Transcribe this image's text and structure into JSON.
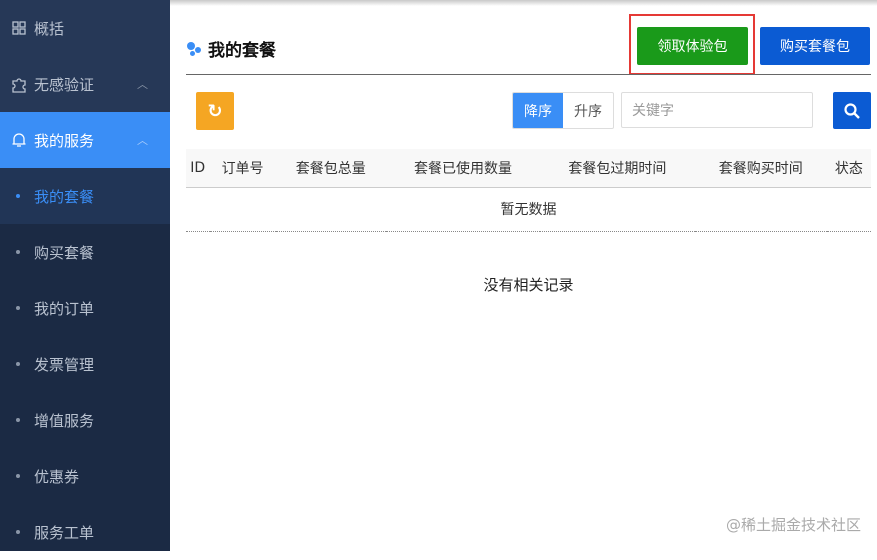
{
  "sidebar": {
    "items": [
      {
        "label": "概括",
        "icon": "grid-icon"
      },
      {
        "label": "无感验证",
        "icon": "puzzle-icon"
      },
      {
        "label": "我的服务",
        "icon": "bell-icon"
      }
    ],
    "subitems": [
      "我的套餐",
      "购买套餐",
      "我的订单",
      "发票管理",
      "增值服务",
      "优惠券",
      "服务工单"
    ]
  },
  "header": {
    "title": "我的套餐",
    "claim_button": "领取体验包",
    "buy_button": "购买套餐包"
  },
  "toolbar": {
    "desc": "降序",
    "asc": "升序",
    "search_placeholder": "关键字"
  },
  "table": {
    "columns": [
      "ID",
      "订单号",
      "套餐包总量",
      "套餐已使用数量",
      "套餐包过期时间",
      "套餐购买时间",
      "状态"
    ],
    "empty": "暂无数据"
  },
  "no_records": "没有相关记录",
  "watermark": "@稀土掘金技术社区",
  "colors": {
    "accent": "#3a8ef6",
    "claim": "#1a9a1a",
    "buy": "#0b5bd3",
    "refresh": "#f5a623",
    "highlight": "#e53935"
  }
}
